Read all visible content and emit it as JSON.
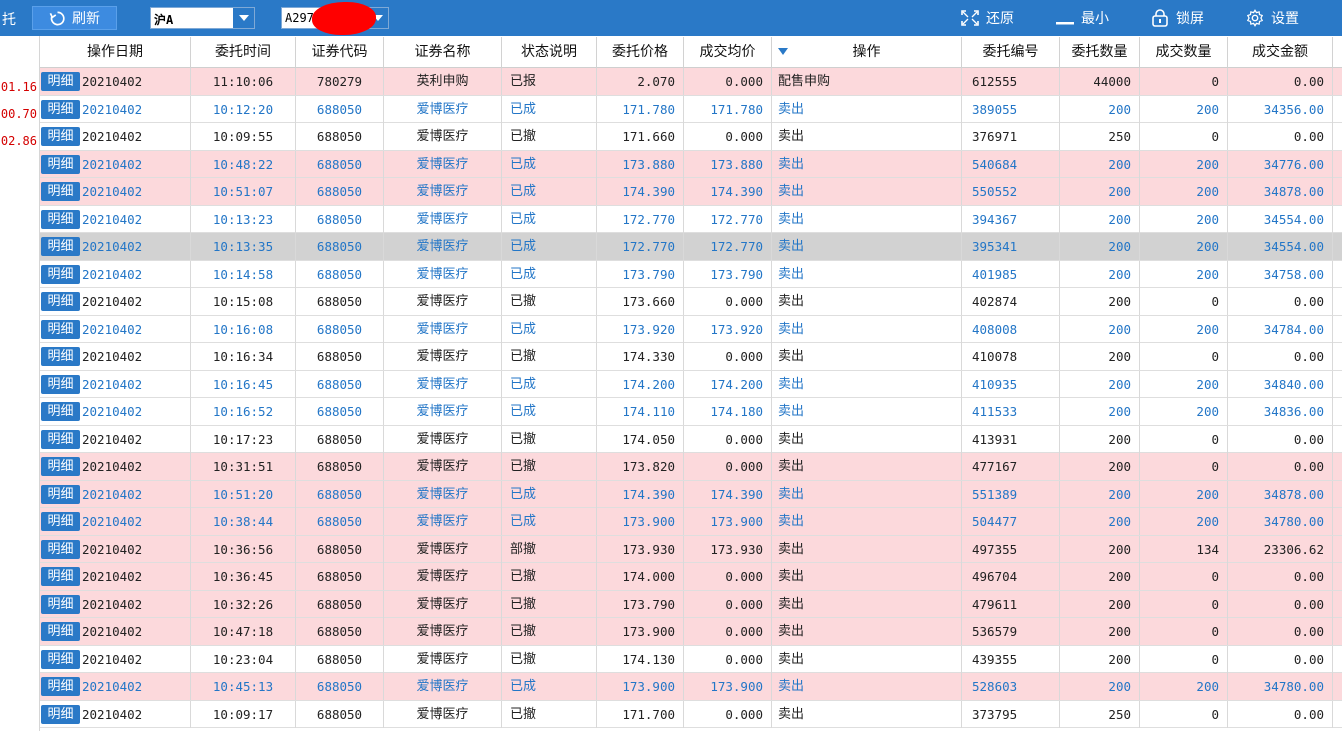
{
  "topbar": {
    "title_fragment": "托",
    "refresh_label": "刷新",
    "market_value": "沪A",
    "account_value": "A297",
    "restore_label": "还原",
    "minimize_label": "最小",
    "lock_label": "锁屏",
    "settings_label": "设置"
  },
  "left_values": [
    "01.16",
    "00.70",
    "02.86"
  ],
  "columns": [
    "操作日期",
    "委托时间",
    "证券代码",
    "证券名称",
    "状态说明",
    "委托价格",
    "成交均价",
    "操作",
    "委托编号",
    "委托数量",
    "成交数量",
    "成交金额"
  ],
  "detail_label": "明细",
  "rows": [
    {
      "date": "20210402",
      "time": "11:10:06",
      "code": "780279",
      "name": "英利申购",
      "status": "已报",
      "price": "2.070",
      "avg": "0.000",
      "op": "配售申购",
      "no": "612555",
      "qty": "44000",
      "dqty": "0",
      "amt": "0.00",
      "bg": "pink",
      "tone": "dark"
    },
    {
      "date": "20210402",
      "time": "10:12:20",
      "code": "688050",
      "name": "爱博医疗",
      "status": "已成",
      "price": "171.780",
      "avg": "171.780",
      "op": "卖出",
      "no": "389055",
      "qty": "200",
      "dqty": "200",
      "amt": "34356.00",
      "bg": "white",
      "tone": "blue"
    },
    {
      "date": "20210402",
      "time": "10:09:55",
      "code": "688050",
      "name": "爱博医疗",
      "status": "已撤",
      "price": "171.660",
      "avg": "0.000",
      "op": "卖出",
      "no": "376971",
      "qty": "250",
      "dqty": "0",
      "amt": "0.00",
      "bg": "white",
      "tone": "dark"
    },
    {
      "date": "20210402",
      "time": "10:48:22",
      "code": "688050",
      "name": "爱博医疗",
      "status": "已成",
      "price": "173.880",
      "avg": "173.880",
      "op": "卖出",
      "no": "540684",
      "qty": "200",
      "dqty": "200",
      "amt": "34776.00",
      "bg": "pink",
      "tone": "blue"
    },
    {
      "date": "20210402",
      "time": "10:51:07",
      "code": "688050",
      "name": "爱博医疗",
      "status": "已成",
      "price": "174.390",
      "avg": "174.390",
      "op": "卖出",
      "no": "550552",
      "qty": "200",
      "dqty": "200",
      "amt": "34878.00",
      "bg": "pink",
      "tone": "blue"
    },
    {
      "date": "20210402",
      "time": "10:13:23",
      "code": "688050",
      "name": "爱博医疗",
      "status": "已成",
      "price": "172.770",
      "avg": "172.770",
      "op": "卖出",
      "no": "394367",
      "qty": "200",
      "dqty": "200",
      "amt": "34554.00",
      "bg": "white",
      "tone": "blue"
    },
    {
      "date": "20210402",
      "time": "10:13:35",
      "code": "688050",
      "name": "爱博医疗",
      "status": "已成",
      "price": "172.770",
      "avg": "172.770",
      "op": "卖出",
      "no": "395341",
      "qty": "200",
      "dqty": "200",
      "amt": "34554.00",
      "bg": "sel",
      "tone": "blue"
    },
    {
      "date": "20210402",
      "time": "10:14:58",
      "code": "688050",
      "name": "爱博医疗",
      "status": "已成",
      "price": "173.790",
      "avg": "173.790",
      "op": "卖出",
      "no": "401985",
      "qty": "200",
      "dqty": "200",
      "amt": "34758.00",
      "bg": "white",
      "tone": "blue"
    },
    {
      "date": "20210402",
      "time": "10:15:08",
      "code": "688050",
      "name": "爱博医疗",
      "status": "已撤",
      "price": "173.660",
      "avg": "0.000",
      "op": "卖出",
      "no": "402874",
      "qty": "200",
      "dqty": "0",
      "amt": "0.00",
      "bg": "white",
      "tone": "dark"
    },
    {
      "date": "20210402",
      "time": "10:16:08",
      "code": "688050",
      "name": "爱博医疗",
      "status": "已成",
      "price": "173.920",
      "avg": "173.920",
      "op": "卖出",
      "no": "408008",
      "qty": "200",
      "dqty": "200",
      "amt": "34784.00",
      "bg": "white",
      "tone": "blue"
    },
    {
      "date": "20210402",
      "time": "10:16:34",
      "code": "688050",
      "name": "爱博医疗",
      "status": "已撤",
      "price": "174.330",
      "avg": "0.000",
      "op": "卖出",
      "no": "410078",
      "qty": "200",
      "dqty": "0",
      "amt": "0.00",
      "bg": "white",
      "tone": "dark"
    },
    {
      "date": "20210402",
      "time": "10:16:45",
      "code": "688050",
      "name": "爱博医疗",
      "status": "已成",
      "price": "174.200",
      "avg": "174.200",
      "op": "卖出",
      "no": "410935",
      "qty": "200",
      "dqty": "200",
      "amt": "34840.00",
      "bg": "white",
      "tone": "blue"
    },
    {
      "date": "20210402",
      "time": "10:16:52",
      "code": "688050",
      "name": "爱博医疗",
      "status": "已成",
      "price": "174.110",
      "avg": "174.180",
      "op": "卖出",
      "no": "411533",
      "qty": "200",
      "dqty": "200",
      "amt": "34836.00",
      "bg": "white",
      "tone": "blue"
    },
    {
      "date": "20210402",
      "time": "10:17:23",
      "code": "688050",
      "name": "爱博医疗",
      "status": "已撤",
      "price": "174.050",
      "avg": "0.000",
      "op": "卖出",
      "no": "413931",
      "qty": "200",
      "dqty": "0",
      "amt": "0.00",
      "bg": "white",
      "tone": "dark"
    },
    {
      "date": "20210402",
      "time": "10:31:51",
      "code": "688050",
      "name": "爱博医疗",
      "status": "已撤",
      "price": "173.820",
      "avg": "0.000",
      "op": "卖出",
      "no": "477167",
      "qty": "200",
      "dqty": "0",
      "amt": "0.00",
      "bg": "pink",
      "tone": "dark"
    },
    {
      "date": "20210402",
      "time": "10:51:20",
      "code": "688050",
      "name": "爱博医疗",
      "status": "已成",
      "price": "174.390",
      "avg": "174.390",
      "op": "卖出",
      "no": "551389",
      "qty": "200",
      "dqty": "200",
      "amt": "34878.00",
      "bg": "pink",
      "tone": "blue"
    },
    {
      "date": "20210402",
      "time": "10:38:44",
      "code": "688050",
      "name": "爱博医疗",
      "status": "已成",
      "price": "173.900",
      "avg": "173.900",
      "op": "卖出",
      "no": "504477",
      "qty": "200",
      "dqty": "200",
      "amt": "34780.00",
      "bg": "pink",
      "tone": "blue"
    },
    {
      "date": "20210402",
      "time": "10:36:56",
      "code": "688050",
      "name": "爱博医疗",
      "status": "部撤",
      "price": "173.930",
      "avg": "173.930",
      "op": "卖出",
      "no": "497355",
      "qty": "200",
      "dqty": "134",
      "amt": "23306.62",
      "bg": "pink",
      "tone": "dark"
    },
    {
      "date": "20210402",
      "time": "10:36:45",
      "code": "688050",
      "name": "爱博医疗",
      "status": "已撤",
      "price": "174.000",
      "avg": "0.000",
      "op": "卖出",
      "no": "496704",
      "qty": "200",
      "dqty": "0",
      "amt": "0.00",
      "bg": "pink",
      "tone": "dark"
    },
    {
      "date": "20210402",
      "time": "10:32:26",
      "code": "688050",
      "name": "爱博医疗",
      "status": "已撤",
      "price": "173.790",
      "avg": "0.000",
      "op": "卖出",
      "no": "479611",
      "qty": "200",
      "dqty": "0",
      "amt": "0.00",
      "bg": "pink",
      "tone": "dark"
    },
    {
      "date": "20210402",
      "time": "10:47:18",
      "code": "688050",
      "name": "爱博医疗",
      "status": "已撤",
      "price": "173.900",
      "avg": "0.000",
      "op": "卖出",
      "no": "536579",
      "qty": "200",
      "dqty": "0",
      "amt": "0.00",
      "bg": "pink",
      "tone": "dark"
    },
    {
      "date": "20210402",
      "time": "10:23:04",
      "code": "688050",
      "name": "爱博医疗",
      "status": "已撤",
      "price": "174.130",
      "avg": "0.000",
      "op": "卖出",
      "no": "439355",
      "qty": "200",
      "dqty": "0",
      "amt": "0.00",
      "bg": "white",
      "tone": "dark"
    },
    {
      "date": "20210402",
      "time": "10:45:13",
      "code": "688050",
      "name": "爱博医疗",
      "status": "已成",
      "price": "173.900",
      "avg": "173.900",
      "op": "卖出",
      "no": "528603",
      "qty": "200",
      "dqty": "200",
      "amt": "34780.00",
      "bg": "pink",
      "tone": "blue"
    },
    {
      "date": "20210402",
      "time": "10:09:17",
      "code": "688050",
      "name": "爱博医疗",
      "status": "已撤",
      "price": "171.700",
      "avg": "0.000",
      "op": "卖出",
      "no": "373795",
      "qty": "250",
      "dqty": "0",
      "amt": "0.00",
      "bg": "white",
      "tone": "dark"
    }
  ]
}
